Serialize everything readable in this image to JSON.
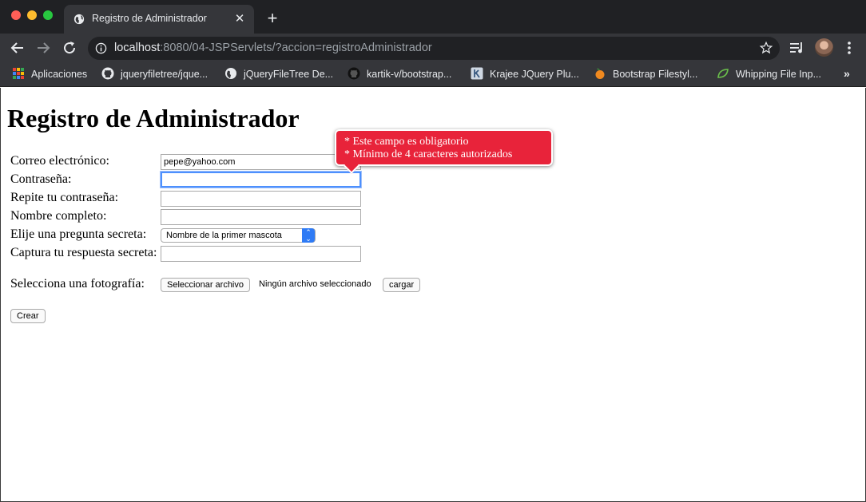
{
  "browser": {
    "tab_title": "Registro de Administrador",
    "url_host": "localhost",
    "url_rest": ":8080/04-JSPServlets/?accion=registroAdministrador",
    "bookmarks": [
      "Aplicaciones",
      "jqueryfiletree/jque...",
      "jQueryFileTree De...",
      "kartik-v/bootstrap...",
      "Krajee JQuery Plu...",
      "Bootstrap Filestyl...",
      "Whipping File Inp..."
    ],
    "bookmarks_overflow": "»"
  },
  "page": {
    "heading": "Registro de Administrador",
    "form": {
      "email_label": "Correo electrónico:",
      "email_value": "pepe@yahoo.com",
      "password_label": "Contraseña:",
      "password_value": "",
      "repeat_password_label": "Repite tu contraseña:",
      "repeat_password_value": "",
      "fullname_label": "Nombre completo:",
      "fullname_value": "",
      "question_label": "Elije una pregunta secreta:",
      "question_selected": "Nombre de la primer mascota",
      "answer_label": "Captura tu respuesta secreta:",
      "answer_value": "",
      "photo_label": "Selecciona una fotografía:",
      "file_button": "Seleccionar archivo",
      "file_status": "Ningún archivo seleccionado",
      "upload_button": "cargar",
      "submit_button": "Crear"
    },
    "validation_tooltip": {
      "line1": "* Este campo es obligatorio",
      "line2": "* Mínimo de 4 caracteres autorizados"
    }
  },
  "colors": {
    "tooltip_bg": "#e8233a",
    "focus_ring": "#4d90fe",
    "select_accent": "#2f7bf5"
  }
}
